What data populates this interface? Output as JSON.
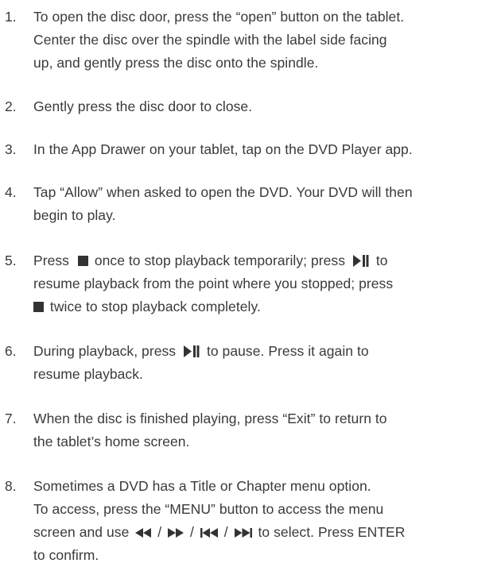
{
  "steps": [
    {
      "number": "1.",
      "lines": [
        "To open the disc door, press the “open” button on the tablet.",
        "Center the disc over the spindle with the label side facing",
        "up, and gently press the disc onto the spindle."
      ]
    },
    {
      "number": "2.",
      "lines": [
        "Gently press the disc door to close."
      ]
    },
    {
      "number": "3.",
      "lines": [
        "In the App Drawer on your tablet, tap on the DVD Player app."
      ]
    },
    {
      "number": "4.",
      "lines": [
        "Tap “Allow” when asked to open the DVD. Your DVD will then",
        "begin to play."
      ]
    },
    {
      "number": "5.",
      "segments": {
        "l1_a": "Press",
        "l1_b": "once to stop playback temporarily; press",
        "l1_c": "to",
        "l2": "resume playback from the point where you stopped; press",
        "l3": "twice to stop playback completely."
      }
    },
    {
      "number": "6.",
      "segments": {
        "l1_a": "During playback, press",
        "l1_b": "to pause. Press it again to",
        "l2": "resume playback."
      }
    },
    {
      "number": "7.",
      "lines": [
        "When the disc is finished playing, press “Exit” to return to",
        "the tablet’s home screen."
      ]
    },
    {
      "number": "8.",
      "segments": {
        "l1": "Sometimes a DVD has a Title or Chapter menu option.",
        "l2": "To access, press the “MENU” button to access the menu",
        "l3_a": "screen and use",
        "sep": "/",
        "l3_b": "to select. Press ENTER",
        "l4": "to confirm."
      }
    }
  ],
  "icons": {
    "stop": "stop-square-icon",
    "play_pause": "play-pause-icon",
    "rewind": "rewind-icon",
    "fast_forward": "fast-forward-icon",
    "skip_previous": "skip-previous-icon",
    "skip_next": "skip-next-icon"
  },
  "colors": {
    "text": "#3a3a3a",
    "icon": "#333333"
  }
}
